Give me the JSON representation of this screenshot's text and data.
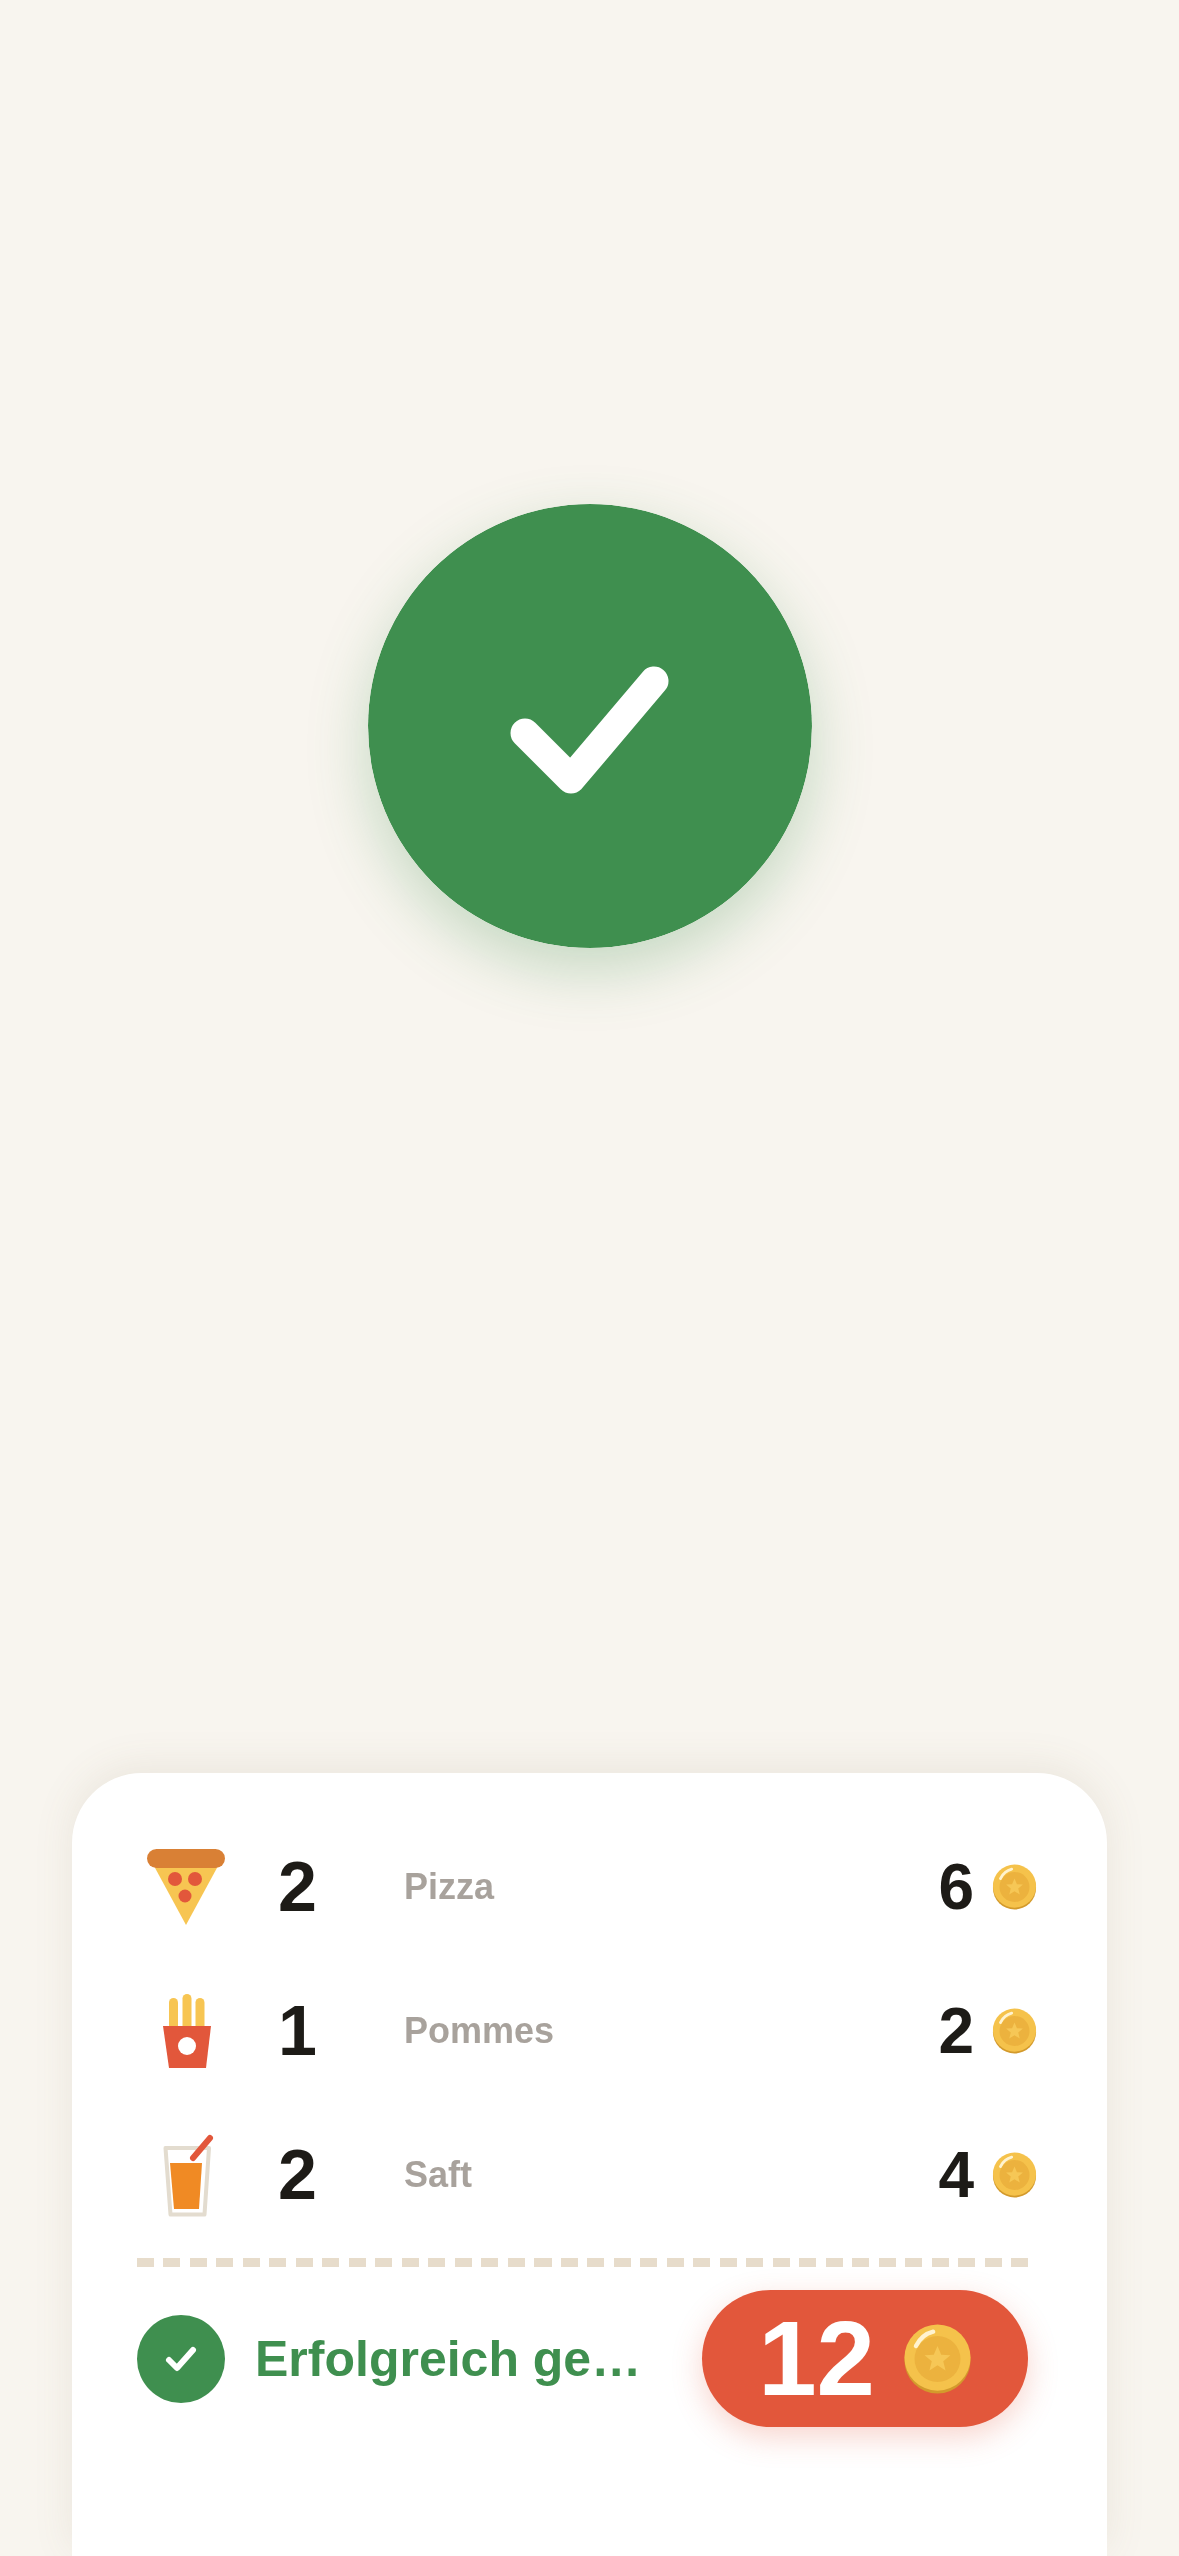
{
  "items": [
    {
      "kind": "pizza",
      "quantity": "2",
      "name": "Pizza",
      "price": "6"
    },
    {
      "kind": "fries",
      "quantity": "1",
      "name": "Pommes",
      "price": "2"
    },
    {
      "kind": "juice",
      "quantity": "2",
      "name": "Saft",
      "price": "4"
    }
  ],
  "footer": {
    "status": "Erfolgreich ge…",
    "total": "12"
  }
}
